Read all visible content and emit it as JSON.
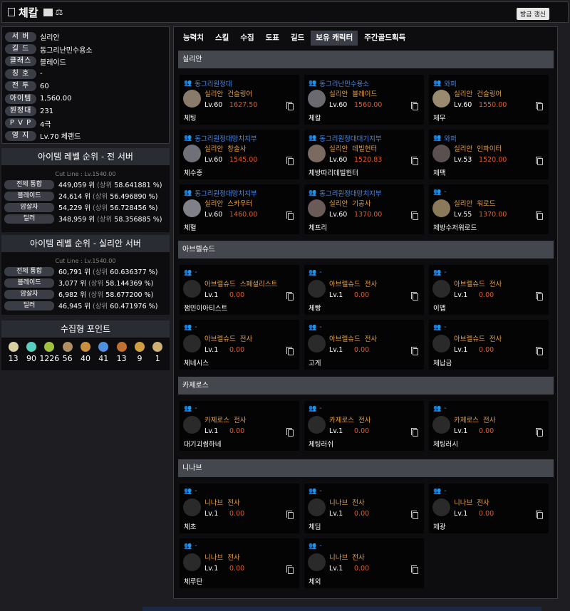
{
  "header": {
    "title": "체칼",
    "refresh": "방금 갱신"
  },
  "info": [
    {
      "label": "서 버",
      "value": "실리안"
    },
    {
      "label": "길 드",
      "value": "동그리난민수용소"
    },
    {
      "label": "클래스",
      "value": "블레이드"
    },
    {
      "label": "칭 호",
      "value": "-"
    },
    {
      "label": "전 투",
      "value": "60"
    },
    {
      "label": "아이템",
      "value": "1,560.00"
    },
    {
      "label": "원정대",
      "value": "231"
    },
    {
      "label": "P V P",
      "value": "4극"
    },
    {
      "label": "영 지",
      "value": "Lv.70 체랜드"
    }
  ],
  "rank_all": {
    "title": "아이템 레벨 순위 - 전 서버",
    "cutline": "Cut Line : Lv.1540.00",
    "rows": [
      {
        "label": "전체 통합",
        "rank": "449,059 위",
        "pct": "58.641881 %"
      },
      {
        "label": "블레이드",
        "rank": "24,614 위",
        "pct": "56.496890 %"
      },
      {
        "label": "암살자",
        "rank": "54,229 위",
        "pct": "56.728456 %"
      },
      {
        "label": "딜러",
        "rank": "348,959 위",
        "pct": "58.356885 %"
      }
    ]
  },
  "rank_server": {
    "title": "아이템 레벨 순위 - 실리안 서버",
    "cutline": "Cut Line : Lv.1540.00",
    "rows": [
      {
        "label": "전체 통합",
        "rank": "60,791 위",
        "pct": "60.636377 %"
      },
      {
        "label": "블레이드",
        "rank": "3,077 위",
        "pct": "58.144369 %"
      },
      {
        "label": "암살자",
        "rank": "6,982 위",
        "pct": "58.677200 %"
      },
      {
        "label": "딜러",
        "rank": "46,945 위",
        "pct": "60.471976 %"
      }
    ]
  },
  "rank_word": "(상위",
  "collect": {
    "title": "수집형 포인트",
    "items": [
      {
        "icon": "mokoko-seed-icon",
        "color": "#d8d0a0",
        "value": "13"
      },
      {
        "icon": "island-heart-icon",
        "color": "#58d0c0",
        "value": "90"
      },
      {
        "icon": "mokoko-icon",
        "color": "#a0c040",
        "value": "1226"
      },
      {
        "icon": "art-icon",
        "color": "#b09060",
        "value": "56"
      },
      {
        "icon": "giant-heart-icon",
        "color": "#c89040",
        "value": "40"
      },
      {
        "icon": "star-icon",
        "color": "#5090e0",
        "value": "41"
      },
      {
        "icon": "ignea-icon",
        "color": "#c07030",
        "value": "13"
      },
      {
        "icon": "orpheus-star-icon",
        "color": "#d0a040",
        "value": "9"
      },
      {
        "icon": "world-tree-leaf-icon",
        "color": "#d0b070",
        "value": "1"
      }
    ]
  },
  "tabs": [
    "능력치",
    "스킬",
    "수집",
    "도표",
    "길드",
    "보유 캐릭터",
    "주간골드획득"
  ],
  "sections": [
    {
      "name": "실리안",
      "chars": [
        {
          "guild": "동그리원정대",
          "server": "실리안",
          "cls": "건슬링어",
          "lvl": "Lv.60",
          "ilvl": "1627.50",
          "name": "체팅",
          "av": "#8a7a6a"
        },
        {
          "guild": "동그리난민수용소",
          "server": "실리안",
          "cls": "블레이드",
          "lvl": "Lv.60",
          "ilvl": "1560.00",
          "name": "체칼",
          "av": "#6a6a70"
        },
        {
          "guild": "와퍼",
          "server": "실리안",
          "cls": "건슬링어",
          "lvl": "Lv.60",
          "ilvl": "1550.00",
          "name": "체무",
          "av": "#9a8a70"
        },
        {
          "guild": "동그리원정대망치지부",
          "server": "실리안",
          "cls": "창술사",
          "lvl": "Lv.60",
          "ilvl": "1545.00",
          "name": "체수종",
          "av": "#707078"
        },
        {
          "guild": "동그리원정대대기지부",
          "server": "실리안",
          "cls": "데빌헌터",
          "lvl": "Lv.60",
          "ilvl": "1520.83",
          "name": "체방따리데빌헌터",
          "av": "#7a6a60"
        },
        {
          "guild": "와퍼",
          "server": "실리안",
          "cls": "인파이터",
          "lvl": "Lv.53",
          "ilvl": "1520.00",
          "name": "체팩",
          "av": "#5a5050"
        },
        {
          "guild": "동그리원정대망치지부",
          "server": "실리안",
          "cls": "스카우터",
          "lvl": "Lv.60",
          "ilvl": "1460.00",
          "name": "체혈",
          "av": "#808088"
        },
        {
          "guild": "동그리원정대망치지부",
          "server": "실리안",
          "cls": "기공사",
          "lvl": "Lv.60",
          "ilvl": "1370.00",
          "name": "체프리",
          "av": "#6a5a58"
        },
        {
          "guild": "-",
          "server": "실리안",
          "cls": "워로드",
          "lvl": "Lv.55",
          "ilvl": "1370.00",
          "name": "체방수저워로드",
          "av": "#8a7a5a"
        }
      ]
    },
    {
      "name": "아브렐슈드",
      "chars": [
        {
          "guild": "-",
          "server": "아브렐슈드",
          "cls": "스페셜리스트",
          "lvl": "Lv.1",
          "ilvl": "0.00",
          "name": "잼민이아티스트",
          "av": "#2a2a2a"
        },
        {
          "guild": "-",
          "server": "아브렐슈드",
          "cls": "전사",
          "lvl": "Lv.1",
          "ilvl": "0.00",
          "name": "체빵",
          "av": "#2a2a2a"
        },
        {
          "guild": "-",
          "server": "아브렐슈드",
          "cls": "전사",
          "lvl": "Lv.1",
          "ilvl": "0.00",
          "name": "이맵",
          "av": "#2a2a2a"
        },
        {
          "guild": "-",
          "server": "아브렐슈드",
          "cls": "전사",
          "lvl": "Lv.1",
          "ilvl": "0.00",
          "name": "체네시스",
          "av": "#2a2a2a"
        },
        {
          "guild": "-",
          "server": "아브렐슈드",
          "cls": "전사",
          "lvl": "Lv.1",
          "ilvl": "0.00",
          "name": "고게",
          "av": "#2a2a2a"
        },
        {
          "guild": "-",
          "server": "아브렐슈드",
          "cls": "전사",
          "lvl": "Lv.1",
          "ilvl": "0.00",
          "name": "체납금",
          "av": "#2a2a2a"
        }
      ]
    },
    {
      "name": "카제로스",
      "chars": [
        {
          "guild": "-",
          "server": "카제로스",
          "cls": "전사",
          "lvl": "Lv.1",
          "ilvl": "0.00",
          "name": "대기괴씸하네",
          "av": "#2a2a2a"
        },
        {
          "guild": "-",
          "server": "카제로스",
          "cls": "전사",
          "lvl": "Lv.1",
          "ilvl": "0.00",
          "name": "체팅러쉬",
          "av": "#2a2a2a"
        },
        {
          "guild": "-",
          "server": "카제로스",
          "cls": "전사",
          "lvl": "Lv.1",
          "ilvl": "0.00",
          "name": "체팅러시",
          "av": "#2a2a2a"
        }
      ]
    },
    {
      "name": "니나브",
      "chars": [
        {
          "guild": "-",
          "server": "니나브",
          "cls": "전사",
          "lvl": "Lv.1",
          "ilvl": "0.00",
          "name": "체초",
          "av": "#2a2a2a"
        },
        {
          "guild": "-",
          "server": "니나브",
          "cls": "전사",
          "lvl": "Lv.1",
          "ilvl": "0.00",
          "name": "체딤",
          "av": "#2a2a2a"
        },
        {
          "guild": "-",
          "server": "니나브",
          "cls": "전사",
          "lvl": "Lv.1",
          "ilvl": "0.00",
          "name": "체광",
          "av": "#2a2a2a"
        },
        {
          "guild": "-",
          "server": "니나브",
          "cls": "전사",
          "lvl": "Lv.1",
          "ilvl": "0.00",
          "name": "체루탄",
          "av": "#2a2a2a"
        },
        {
          "guild": "-",
          "server": "니나브",
          "cls": "전사",
          "lvl": "Lv.1",
          "ilvl": "0.00",
          "name": "체외",
          "av": "#2a2a2a"
        }
      ]
    }
  ]
}
